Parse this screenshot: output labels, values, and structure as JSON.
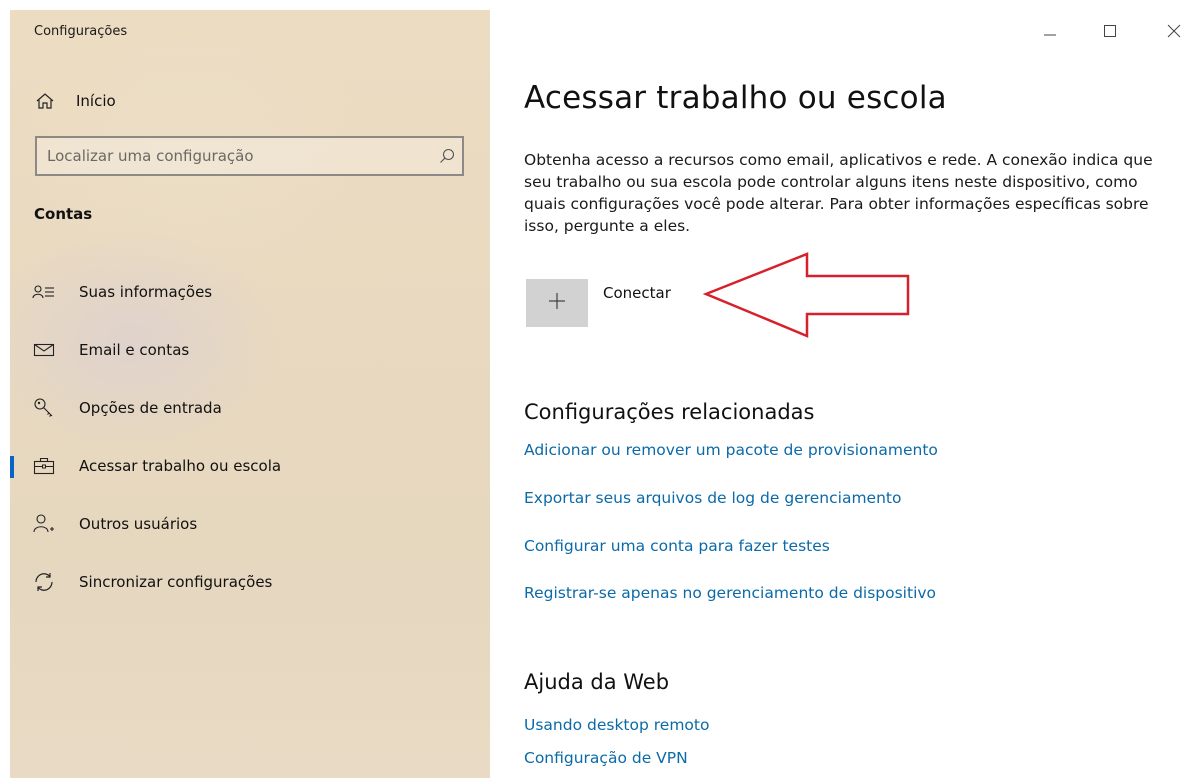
{
  "window": {
    "title": "Configurações",
    "controls": [
      "minimize-icon",
      "maximize-icon",
      "close-icon"
    ]
  },
  "sidebar": {
    "home_label": "Início",
    "search_placeholder": "Localizar uma configuração",
    "section_title": "Contas",
    "items": [
      {
        "label": "Suas informações",
        "icon": "user-info-icon"
      },
      {
        "label": "Email e contas",
        "icon": "mail-icon"
      },
      {
        "label": "Opções de entrada",
        "icon": "key-icon"
      },
      {
        "label": "Acessar trabalho ou escola",
        "icon": "briefcase-icon",
        "active": true
      },
      {
        "label": "Outros usuários",
        "icon": "add-person-icon"
      },
      {
        "label": "Sincronizar configurações",
        "icon": "sync-icon"
      }
    ]
  },
  "main": {
    "title": "Acessar trabalho ou escola",
    "description": "Obtenha acesso a recursos como email, aplicativos e rede. A conexão indica que seu trabalho ou sua escola pode controlar alguns itens neste dispositivo, como quais configurações você pode alterar. Para obter informações específicas sobre isso, pergunte a eles.",
    "connect_label": "Conectar",
    "related": {
      "title": "Configurações relacionadas",
      "links": [
        "Adicionar ou remover um pacote de provisionamento",
        "Exportar seus arquivos de log de gerenciamento",
        "Configurar uma conta para fazer testes",
        "Registrar-se apenas no gerenciamento de dispositivo"
      ]
    },
    "web_help": {
      "title": "Ajuda da Web",
      "links": [
        "Usando desktop remoto",
        "Configuração de VPN"
      ]
    }
  },
  "colors": {
    "accent": "#0a64c8",
    "link": "#0b6aa8",
    "annotation_arrow": "#d8202a",
    "sidebar_bg": "#e9d9c0"
  }
}
